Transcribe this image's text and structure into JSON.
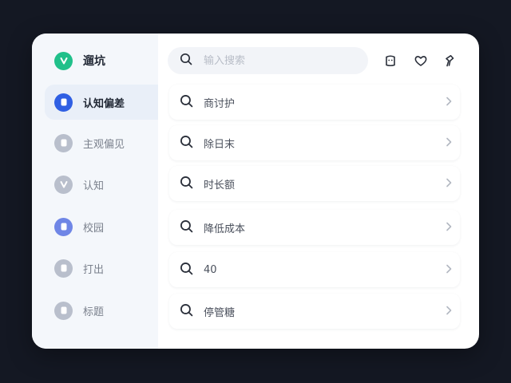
{
  "colors": {
    "backdrop": "#141823",
    "panel": "#ffffff",
    "sidebar": "#f4f7fb",
    "brand_badge": "#20c08a",
    "active_badge": "#2f5fe3",
    "muted_badge": "#b9bfcc",
    "accent_badge": "#6f86e6"
  },
  "brand": {
    "icon": "check-badge-icon",
    "title": "遛坑"
  },
  "search": {
    "icon": "search-icon",
    "value": "",
    "placeholder": "输入搜索"
  },
  "toolbar": {
    "icons": [
      "bag-icon",
      "heart-icon",
      "pin-icon"
    ]
  },
  "sidebar": {
    "items": [
      {
        "label": "认知偏差",
        "icon": "document-badge-icon",
        "active": true
      },
      {
        "label": "主观偏见",
        "icon": "document-badge-icon",
        "active": false
      },
      {
        "label": "认知",
        "icon": "check-badge-icon",
        "active": false
      },
      {
        "label": "校园",
        "icon": "document-badge-icon",
        "active": false
      },
      {
        "label": "打出",
        "icon": "document-badge-icon",
        "active": false
      },
      {
        "label": "标题",
        "icon": "document-badge-icon",
        "active": false
      }
    ]
  },
  "results": {
    "items": [
      {
        "label": "商讨护",
        "icon": "search-icon",
        "chevron": "chevron-right-icon"
      },
      {
        "label": "除日末",
        "icon": "search-icon",
        "chevron": "chevron-right-icon"
      },
      {
        "label": "时长额",
        "icon": "search-icon",
        "chevron": "chevron-right-icon"
      },
      {
        "label": "降低成本",
        "icon": "search-icon",
        "chevron": "chevron-right-icon"
      },
      {
        "label": "40",
        "icon": "search-icon",
        "chevron": "chevron-right-icon"
      },
      {
        "label": "停管糖",
        "icon": "search-icon",
        "chevron": "chevron-right-icon"
      }
    ]
  }
}
